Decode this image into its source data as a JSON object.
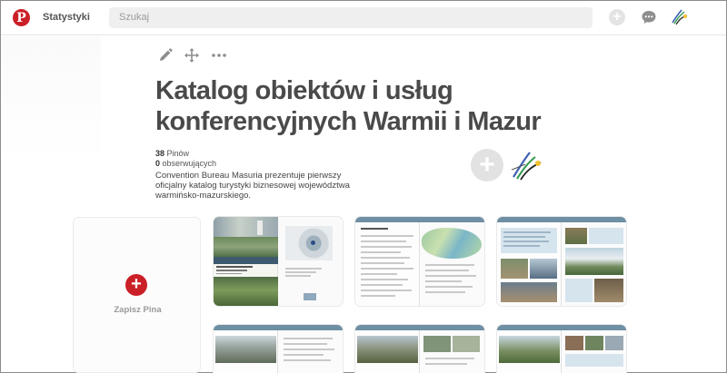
{
  "header": {
    "logo_letter": "P",
    "title": "Statystyki",
    "search_placeholder": "Szukaj"
  },
  "board": {
    "title": "Katalog obiektów i usług konferencyjnych Warmii i Mazur",
    "pins_count": "38",
    "pins_label": "Pinów",
    "followers_count": "0",
    "followers_label": "obserwujących",
    "description": "Convention Bureau Masuria prezentuje pierwszy oficjalny katalog turystyki biznesowej województwa warmińsko-mazurskiego."
  },
  "save_pin": {
    "label": "Zapisz Pina"
  },
  "icons": {
    "edit": "pencil-icon",
    "move": "move-arrows-icon",
    "more": "ellipsis-icon",
    "add": "plus-icon",
    "messages": "chat-bubble-icon"
  },
  "colors": {
    "brand": "#cb1f27",
    "title": "#4a4a4a",
    "pin_strip": "#6f8fa5"
  }
}
